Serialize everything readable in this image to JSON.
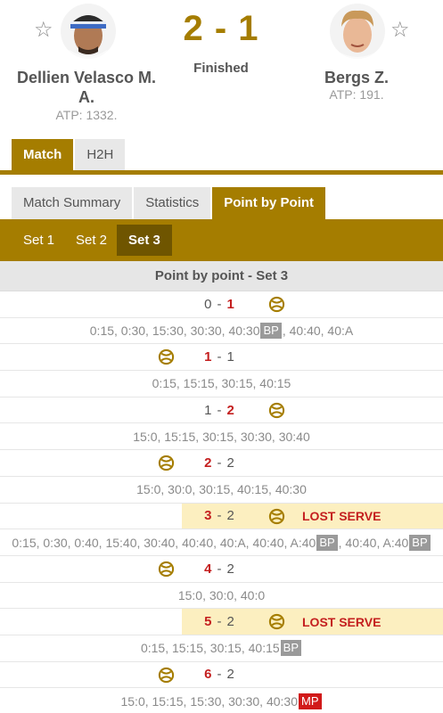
{
  "match": {
    "score": "2 - 1",
    "status": "Finished",
    "home": {
      "name": "Dellien Velasco M. A.",
      "rank": "ATP: 1332."
    },
    "away": {
      "name": "Bergs Z.",
      "rank": "ATP: 191."
    }
  },
  "tabs": [
    "Match",
    "H2H"
  ],
  "subtabs": [
    "Match Summary",
    "Statistics",
    "Point by Point"
  ],
  "set_tabs": [
    "Set 1",
    "Set 2",
    "Set 3"
  ],
  "pbp_title": "Point by point - Set 3",
  "colors": {
    "accent": "#a57d00",
    "win": "#c41f1f",
    "highlight": "#fcefc0"
  },
  "icons": {
    "star": "star-icon",
    "serve": "tennis-ball-icon"
  },
  "games": [
    {
      "home": "0",
      "away": "1",
      "winner": "away",
      "server": "away",
      "lost_serve": false
    },
    {
      "points": [
        {
          "t": "0:15, 0:30, 15:30, 30:30, 40:30"
        },
        {
          "tag": "BP"
        },
        {
          "t": ", 40:40, 40:A"
        }
      ]
    },
    {
      "home": "1",
      "away": "1",
      "winner": "home",
      "server": "home",
      "lost_serve": false
    },
    {
      "points": [
        {
          "t": "0:15, 15:15, 30:15, 40:15"
        }
      ]
    },
    {
      "home": "1",
      "away": "2",
      "winner": "away",
      "server": "away",
      "lost_serve": false
    },
    {
      "points": [
        {
          "t": "15:0, 15:15, 30:15, 30:30, 30:40"
        }
      ]
    },
    {
      "home": "2",
      "away": "2",
      "winner": "home",
      "server": "home",
      "lost_serve": false
    },
    {
      "points": [
        {
          "t": "15:0, 30:0, 30:15, 40:15, 40:30"
        }
      ]
    },
    {
      "home": "3",
      "away": "2",
      "winner": "home",
      "server": "away",
      "lost_serve": true,
      "lost_label": "LOST SERVE"
    },
    {
      "points": [
        {
          "t": "0:15, 0:30, 0:40, 15:40, 30:40, 40:40, 40:A, 40:40, A:40"
        },
        {
          "tag": "BP"
        },
        {
          "t": ", 40:40, A:40"
        },
        {
          "tag": "BP"
        }
      ]
    },
    {
      "home": "4",
      "away": "2",
      "winner": "home",
      "server": "home",
      "lost_serve": false
    },
    {
      "points": [
        {
          "t": "15:0, 30:0, 40:0"
        }
      ]
    },
    {
      "home": "5",
      "away": "2",
      "winner": "home",
      "server": "away",
      "lost_serve": true,
      "lost_label": "LOST SERVE"
    },
    {
      "points": [
        {
          "t": "0:15, 15:15, 30:15, 40:15"
        },
        {
          "tag": "BP"
        }
      ]
    },
    {
      "home": "6",
      "away": "2",
      "winner": "home",
      "server": "home",
      "lost_serve": false
    },
    {
      "points": [
        {
          "t": "15:0, 15:15, 15:30, 30:30, 40:30"
        },
        {
          "tag": "MP"
        }
      ]
    }
  ]
}
